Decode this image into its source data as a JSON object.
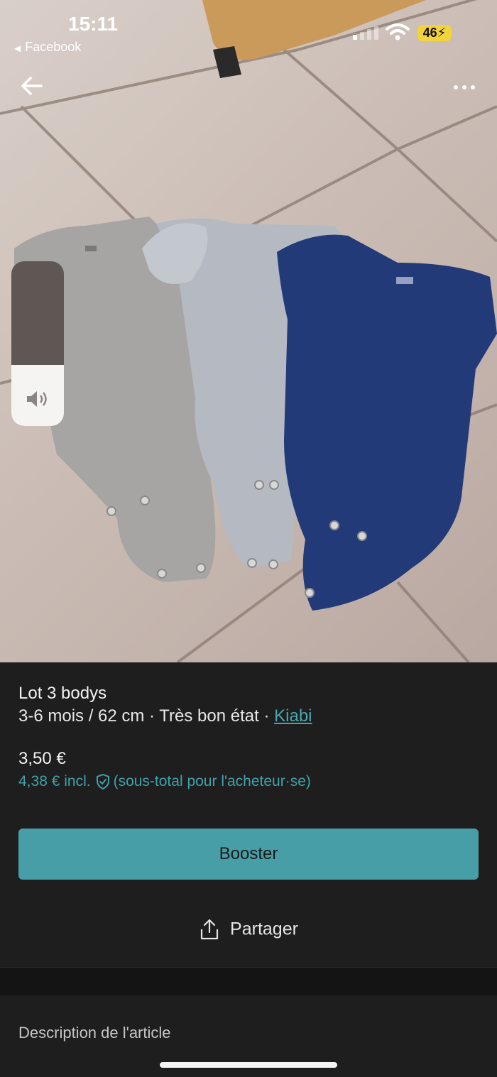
{
  "status_bar": {
    "time": "15:11",
    "back_app": "Facebook",
    "battery": "46",
    "icons": [
      "signal-icon",
      "wifi-icon",
      "battery-charging-icon"
    ]
  },
  "nav": {
    "back_icon": "arrow-left-icon",
    "more_icon": "more-dots-icon"
  },
  "volume_hud": {
    "icon": "speaker-icon",
    "level": 0.37
  },
  "listing": {
    "title": "Lot 3 bodys",
    "details": "3-6 mois / 62 cm · Très bon état · ",
    "brand": "Kiabi",
    "price": "3,50 €",
    "price_incl": "4,38 € incl.",
    "price_incl_note": "(sous-total pour l'acheteur·se)",
    "booster_label": "Booster",
    "share_label": "Partager"
  },
  "description": {
    "title": "Description de l'article"
  },
  "colors": {
    "accent": "#479ea6",
    "link": "#4aa7ae",
    "background": "#1e1e1e"
  }
}
